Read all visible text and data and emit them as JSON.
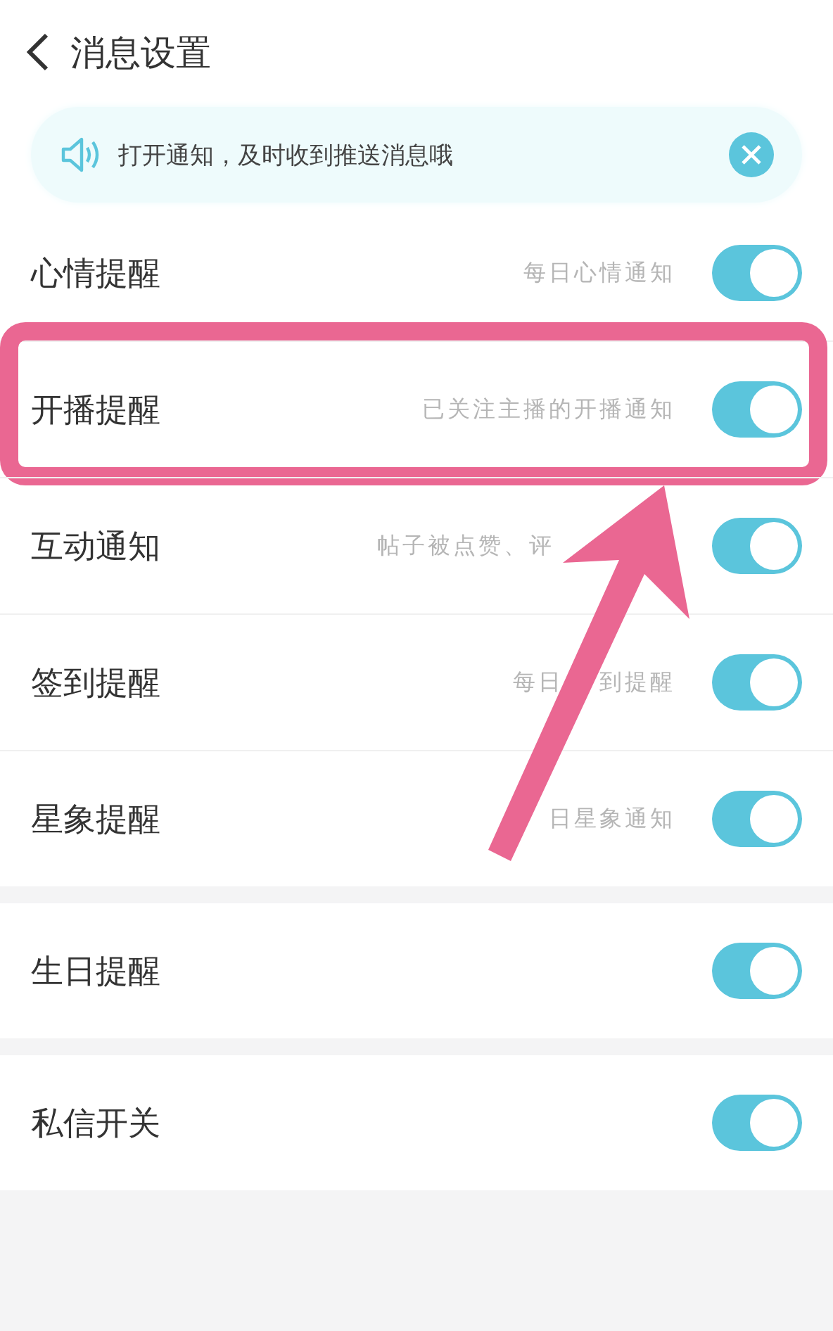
{
  "header": {
    "title": "消息设置"
  },
  "banner": {
    "text": "打开通知，及时收到推送消息哦"
  },
  "groups": [
    {
      "items": [
        {
          "label": "心情提醒",
          "hint": [
            "每日心情通知"
          ],
          "on": true,
          "highlighted": false,
          "covered_after": false
        },
        {
          "label": "开播提醒",
          "hint": [
            "已关注主播的开播通知"
          ],
          "on": true,
          "highlighted": true,
          "covered_after": false
        },
        {
          "label": "互动通知",
          "hint": [
            "帖子被点赞、评"
          ],
          "on": true,
          "highlighted": false,
          "covered_after": true
        },
        {
          "label": "签到提醒",
          "hint": [
            "每日",
            "到提醒"
          ],
          "on": true,
          "highlighted": false,
          "covered_after": false
        },
        {
          "label": "星象提醒",
          "hint": [
            "日星象通知"
          ],
          "on": true,
          "highlighted": false,
          "covered_after": false
        }
      ]
    },
    {
      "items": [
        {
          "label": "生日提醒",
          "on": true,
          "highlighted": false
        }
      ]
    },
    {
      "items": [
        {
          "label": "私信开关",
          "on": true,
          "highlighted": false
        }
      ]
    }
  ]
}
